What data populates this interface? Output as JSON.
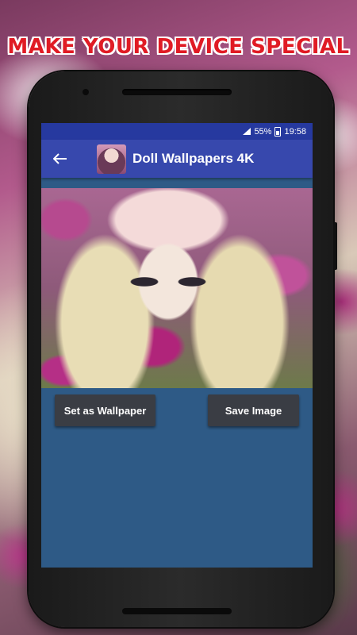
{
  "promo": {
    "headline": "MAKE YOUR DEVICE SPECIAL"
  },
  "status_bar": {
    "battery": "55%",
    "time": "19:58"
  },
  "app_bar": {
    "back_icon": "arrow-left-icon",
    "title": "Doll Wallpapers 4K"
  },
  "actions": {
    "set_wallpaper": "Set as Wallpaper",
    "save_image": "Save Image"
  },
  "colors": {
    "status_bar": "#26399f",
    "app_bar": "#3748ad",
    "screen_bg": "#2e5a86",
    "button": "#3a3d44",
    "headline": "#e01b24"
  }
}
